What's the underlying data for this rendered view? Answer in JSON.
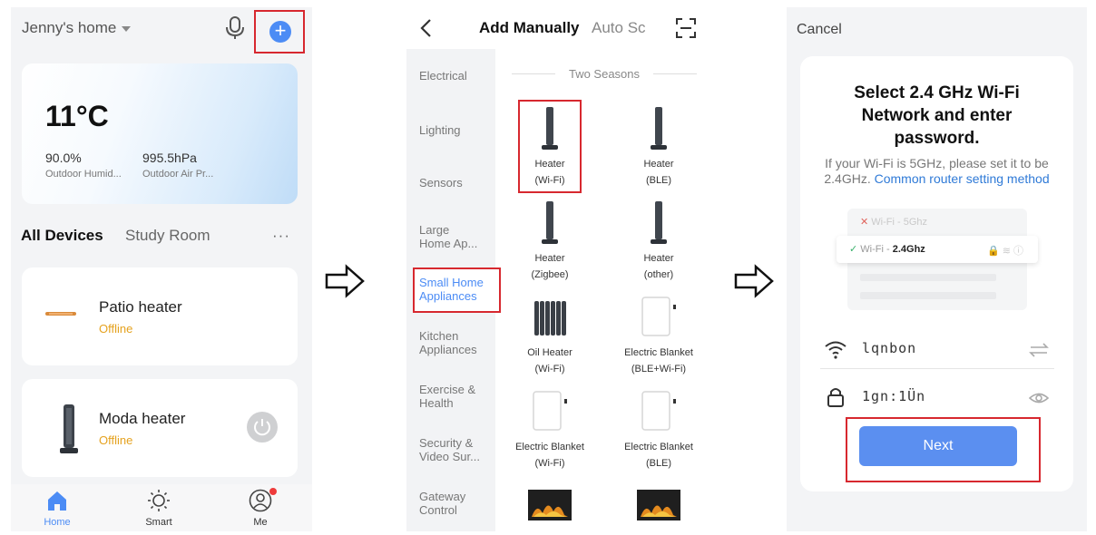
{
  "colors": {
    "accent": "#4c8cf5",
    "highlight": "#d7282f",
    "offline": "#e5a21f",
    "link": "#2f7ad7"
  },
  "screen1": {
    "home_name": "Jenny's home",
    "weather": {
      "temperature": "11°C",
      "humidity_value": "90.0%",
      "humidity_label": "Outdoor Humid...",
      "pressure_value": "995.5hPa",
      "pressure_label": "Outdoor Air Pr..."
    },
    "tabs": [
      "All Devices",
      "Study Room"
    ],
    "more": "···",
    "devices": [
      {
        "name": "Patio heater",
        "status": "Offline"
      },
      {
        "name": "Moda heater",
        "status": "Offline"
      }
    ],
    "nav": [
      {
        "label": "Home",
        "icon": "home-icon"
      },
      {
        "label": "Smart",
        "icon": "sun-icon"
      },
      {
        "label": "Me",
        "icon": "user-icon"
      }
    ]
  },
  "screen2": {
    "tabs": [
      "Add Manually",
      "Auto Sc"
    ],
    "categories": [
      "Electrical",
      "Lighting",
      "Sensors",
      "Large Home Ap...",
      "Small Home Appliances",
      "Kitchen Appliances",
      "Exercise & Health",
      "Security & Video Sur...",
      "Gateway Control"
    ],
    "selected_category": "Small Home Appliances",
    "section_header": "Two Seasons",
    "products": [
      {
        "name": "Heater",
        "variant": "(Wi-Fi)"
      },
      {
        "name": "Heater",
        "variant": "(BLE)"
      },
      {
        "name": "Heater",
        "variant": "(Zigbee)"
      },
      {
        "name": "Heater",
        "variant": "(other)"
      },
      {
        "name": "Oil Heater",
        "variant": "(Wi-Fi)"
      },
      {
        "name": "Electric Blanket",
        "variant": "(BLE+Wi-Fi)"
      },
      {
        "name": "Electric Blanket",
        "variant": "(Wi-Fi)"
      },
      {
        "name": "Electric Blanket",
        "variant": "(BLE)"
      }
    ]
  },
  "screen3": {
    "cancel": "Cancel",
    "title": "Select 2.4 GHz Wi-Fi Network and enter password.",
    "desc_prefix": "If your Wi-Fi is 5GHz, please set it to be 2.4GHz.",
    "desc_link": "Common router setting method",
    "illustration": {
      "row1_prefix": "Wi-Fi - ",
      "row1_band": "5Ghz",
      "row2_prefix": "Wi-Fi - ",
      "row2_band": "2.4Ghz"
    },
    "ssid_value": "lqnbon",
    "password_value": "1gn:1Ün",
    "next_label": "Next"
  }
}
